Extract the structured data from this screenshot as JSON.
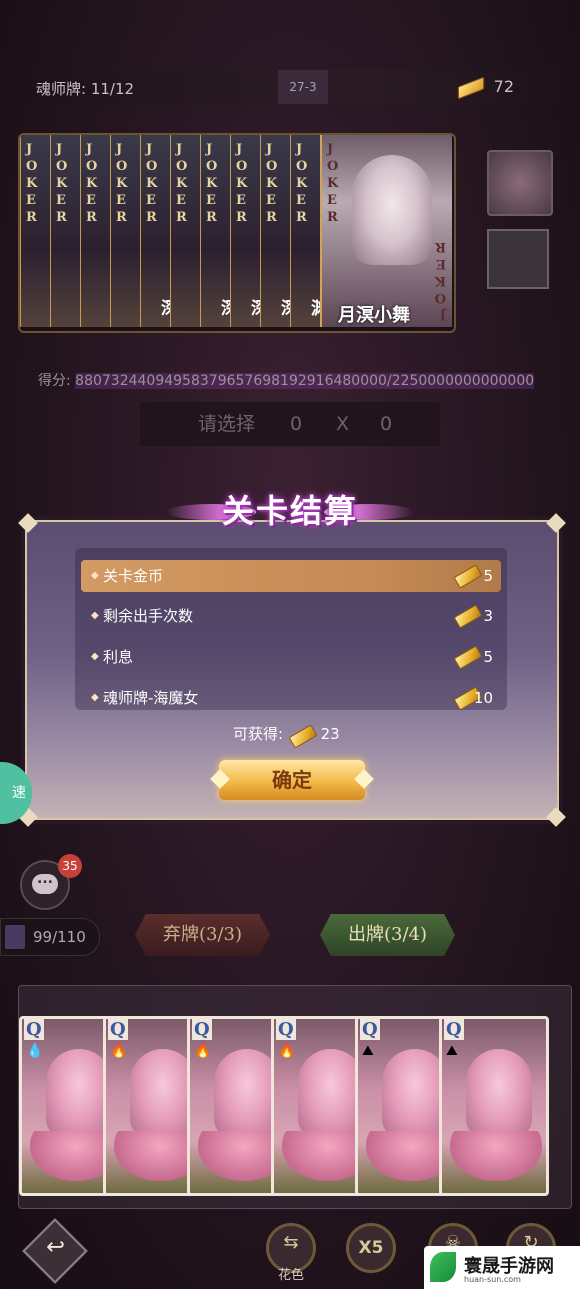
{
  "topbar": {
    "soul_cards_label": "魂师牌: 11/12",
    "stage": "27-3",
    "coins": "72"
  },
  "jokers": {
    "label": "JOKER",
    "small_cards": [
      {
        "bottom": ""
      },
      {
        "bottom": ""
      },
      {
        "bottom": ""
      },
      {
        "bottom": ""
      },
      {
        "bottom": "深"
      },
      {
        "bottom": ""
      },
      {
        "bottom": "深"
      },
      {
        "bottom": "深"
      },
      {
        "bottom": "深"
      },
      {
        "bottom": "渊"
      }
    ],
    "featured_name": "月溟小舞"
  },
  "score": {
    "label": "得分:",
    "value": "88073244094958379657698192916480000/2250000000000000"
  },
  "selection": {
    "label": "请选择",
    "chips": "0",
    "times": "X",
    "mult": "0"
  },
  "settlement": {
    "title": "关卡结算",
    "rows": [
      {
        "label": "关卡金币",
        "amount": "5"
      },
      {
        "label": "剩余出手次数",
        "amount": "3"
      },
      {
        "label": "利息",
        "amount": "5"
      },
      {
        "label": "魂师牌-海魔女",
        "amount": "10"
      }
    ],
    "obtain_label": "可获得:",
    "obtain_amount": "23",
    "confirm_label": "确定"
  },
  "side": {
    "speed_label": "速",
    "chat_badge": "35"
  },
  "deck": {
    "count": "99/110"
  },
  "actions": {
    "discard_label": "弃牌(3/3)",
    "play_label": "出牌(3/4)"
  },
  "hand": {
    "cards": [
      {
        "rank": "Q",
        "suit": "💧"
      },
      {
        "rank": "Q",
        "suit": "🔥"
      },
      {
        "rank": "Q",
        "suit": "🔥"
      },
      {
        "rank": "Q",
        "suit": "🔥"
      },
      {
        "rank": "Q",
        "suit": "⛰"
      },
      {
        "rank": "Q",
        "suit": "⛰"
      }
    ]
  },
  "bottom": {
    "back_icon": "↩",
    "suit_sort_label": "花色",
    "x5_label": "X5"
  },
  "watermark": {
    "brand": "寰晟手游网",
    "url": "huan-sun.com"
  },
  "colors": {
    "accent_gold": "#f2b948",
    "highlight_row": "#d39a63",
    "title_glow": "#b03ec0"
  }
}
